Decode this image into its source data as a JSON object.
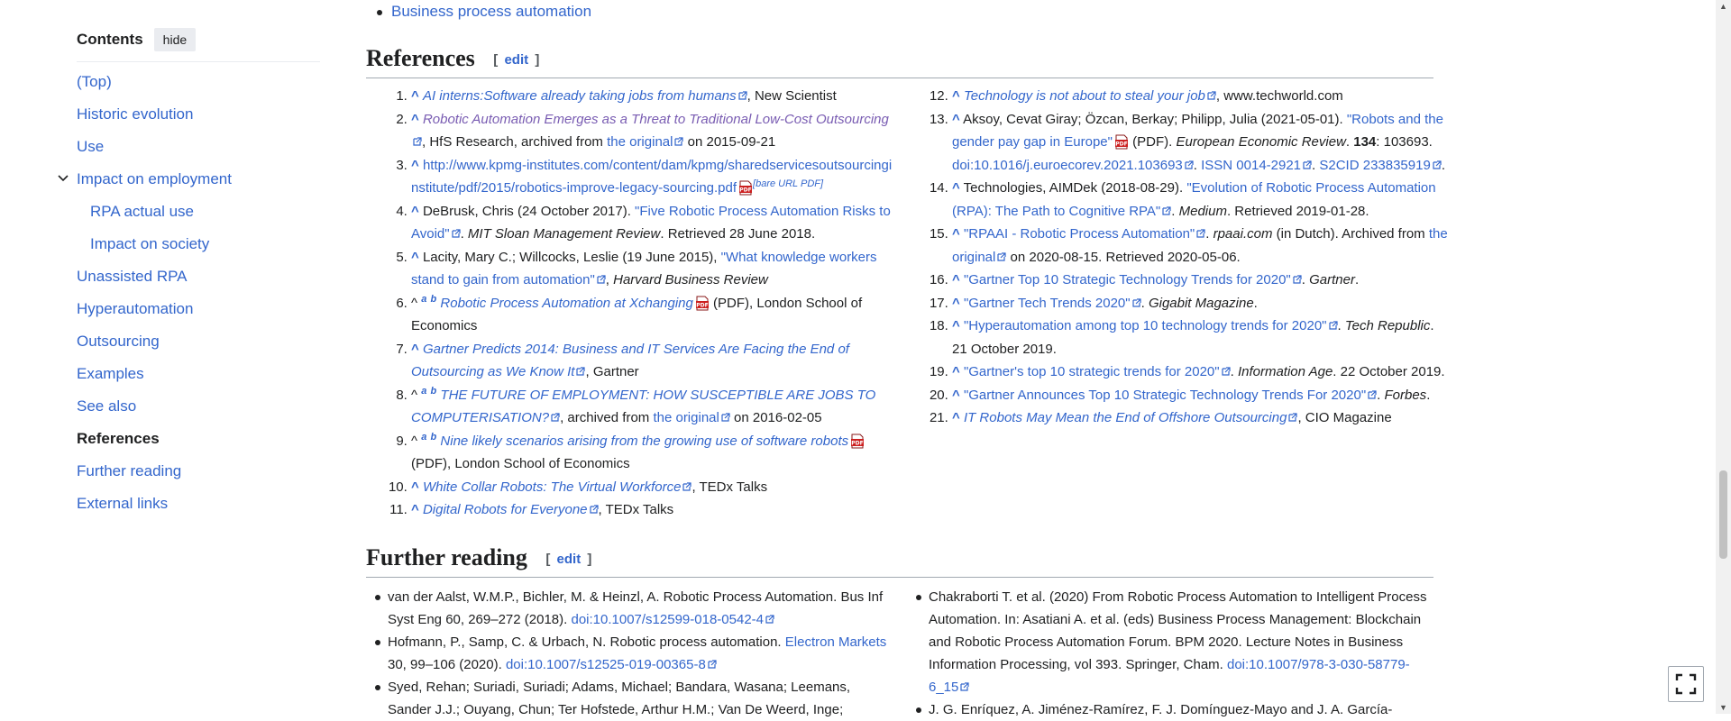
{
  "toc": {
    "title": "Contents",
    "hide_label": "hide",
    "items": [
      {
        "label": "(Top)"
      },
      {
        "label": "Historic evolution"
      },
      {
        "label": "Use"
      },
      {
        "label": "Impact on employment"
      },
      {
        "label": "RPA actual use"
      },
      {
        "label": "Impact on society"
      },
      {
        "label": "Unassisted RPA"
      },
      {
        "label": "Hyperautomation"
      },
      {
        "label": "Outsourcing"
      },
      {
        "label": "Examples"
      },
      {
        "label": "See also"
      },
      {
        "label": "References"
      },
      {
        "label": "Further reading"
      },
      {
        "label": "External links"
      }
    ]
  },
  "see_also_last": "Business process automation",
  "references_heading": "References",
  "further_heading": "Further reading",
  "edit_label": "edit",
  "edit_open": "[",
  "edit_close": "]",
  "caret": "^",
  "refs": {
    "r1": {
      "link": "AI interns:Software already taking jobs from humans",
      "tail": ", New Scientist"
    },
    "r2": {
      "link": "Robotic Automation Emerges as a Threat to Traditional Low-Cost Outsourcing",
      "mid": ", HfS Research, archived from ",
      "orig": "the original",
      "tail": " on 2015-09-21"
    },
    "r3": {
      "link": "http://www.kpmg-institutes.com/content/dam/kpmg/sharedservicesoutsourcinginstitute/pdf/2015/robotics-improve-legacy-sourcing.pdf",
      "note": "[bare URL PDF]"
    },
    "r4": {
      "pre": "DeBrusk, Chris (24 October 2017). ",
      "link": "\"Five Robotic Process Automation Risks to Avoid\"",
      "mid": ". ",
      "work": "MIT Sloan Management Review",
      "tail": ". Retrieved 28 June 2018."
    },
    "r5": {
      "pre": "Lacity, Mary C.; Willcocks, Leslie (19 June 2015), ",
      "link": "\"What knowledge workers stand to gain from automation\"",
      "mid": ", ",
      "work": "Harvard Business Review"
    },
    "r6": {
      "a": "a",
      "b": "b",
      "link": "Robotic Process Automation at Xchanging",
      "tail": " (PDF), London School of Economics"
    },
    "r7": {
      "link": "Gartner Predicts 2014: Business and IT Services Are Facing the End of Outsourcing as We Know It",
      "tail": ", Gartner"
    },
    "r8": {
      "a": "a",
      "b": "b",
      "link": "THE FUTURE OF EMPLOYMENT: HOW SUSCEPTIBLE ARE JOBS TO COMPUTERISATION?",
      "mid": ", archived from ",
      "orig": "the original",
      "tail": " on 2016-02-05"
    },
    "r9": {
      "a": "a",
      "b": "b",
      "link": "Nine likely scenarios arising from the growing use of software robots",
      "tail": " (PDF), London School of Economics"
    },
    "r10": {
      "link": "White Collar Robots: The Virtual Workforce",
      "tail": ", TEDx Talks"
    },
    "r11": {
      "link": "Digital Robots for Everyone",
      "tail": ", TEDx Talks"
    },
    "r12": {
      "link": "Technology is not about to steal your job",
      "tail": ", www.techworld.com"
    },
    "r13": {
      "pre": "Aksoy, Cevat Giray; Özcan, Berkay; Philipp, Julia (2021-05-01). ",
      "link": "\"Robots and the gender pay gap in Europe\"",
      "mid": " (PDF). ",
      "work": "European Economic Review",
      "vol_pre": ". ",
      "vol": "134",
      "pages": ": 103693. ",
      "doi": "doi:10.1016/j.euroecorev.2021.103693",
      "sep": ". ",
      "issn": "ISSN 0014-2921",
      "sep2": ". ",
      "s2cid": "S2CID 233835919",
      "end": "."
    },
    "r14": {
      "pre": "Technologies, AIMDek (2018-08-29). ",
      "link": "\"Evolution of Robotic Process Automation (RPA): The Path to Cognitive RPA\"",
      "mid": ". ",
      "work": "Medium",
      "tail": ". Retrieved 2019-01-28."
    },
    "r15": {
      "link": "\"RPAAI - Robotic Process Automation\"",
      "mid": ". ",
      "work": "rpaai.com",
      "mid2": " (in Dutch). Archived from ",
      "orig": "the original",
      "tail": " on 2020-08-15. Retrieved 2020-05-06."
    },
    "r16": {
      "link": "\"Gartner Top 10 Strategic Technology Trends for 2020\"",
      "mid": ". ",
      "work": "Gartner",
      "tail": "."
    },
    "r17": {
      "link": "\"Gartner Tech Trends 2020\"",
      "mid": ". ",
      "work": "Gigabit Magazine",
      "tail": "."
    },
    "r18": {
      "link": "\"Hyperautomation among top 10 technology trends for 2020\"",
      "mid": ". ",
      "work": "Tech Republic",
      "tail": ". 21 October 2019."
    },
    "r19": {
      "link": "\"Gartner's top 10 strategic trends for 2020\"",
      "mid": ". ",
      "work": "Information Age",
      "tail": ". 22 October 2019."
    },
    "r20": {
      "link": "\"Gartner Announces Top 10 Strategic Technology Trends For 2020\"",
      "mid": ". ",
      "work": "Forbes",
      "tail": "."
    },
    "r21": {
      "link": "IT Robots May Mean the End of Offshore Outsourcing",
      "tail": ", CIO Magazine"
    }
  },
  "further": {
    "f1": {
      "text": "van der Aalst, W.M.P., Bichler, M. & Heinzl, A. Robotic Process Automation. Bus Inf Syst Eng 60, 269–272 (2018). ",
      "doi": "doi:10.1007/s12599-018-0542-4"
    },
    "f2": {
      "pre": "Hofmann, P., Samp, C. & Urbach, N. Robotic process automation. ",
      "link": "Electron Markets",
      "mid": " 30, 99–106 (2020). ",
      "doi": "doi:10.1007/s12525-019-00365-8"
    },
    "f3": {
      "text": "Syed, Rehan; Suriadi, Suriadi; Adams, Michael; Bandara, Wasana; Leemans, Sander J.J.; Ouyang, Chun; Ter Hofstede, Arthur H.M.; Van De Weerd, Inge;"
    },
    "f4": {
      "text": "Chakraborti T. et al. (2020) From Robotic Process Automation to Intelligent Process Automation. In: Asatiani A. et al. (eds) Business Process Management: Blockchain and Robotic Process Automation Forum. BPM 2020. Lecture Notes in Business Information Processing, vol 393. Springer, Cham. ",
      "doi": "doi:10.1007/978-3-030-58779-6_15"
    },
    "f5": {
      "text": "J. G. Enríquez, A. Jiménez-Ramírez, F. J. Domínguez-Mayo and J. A. García-"
    }
  },
  "colors": {
    "link": "#3366cc",
    "visited": "#795cb2",
    "text": "#202122",
    "rule": "#a2a9b1",
    "pdf": "#cc1f1f"
  }
}
